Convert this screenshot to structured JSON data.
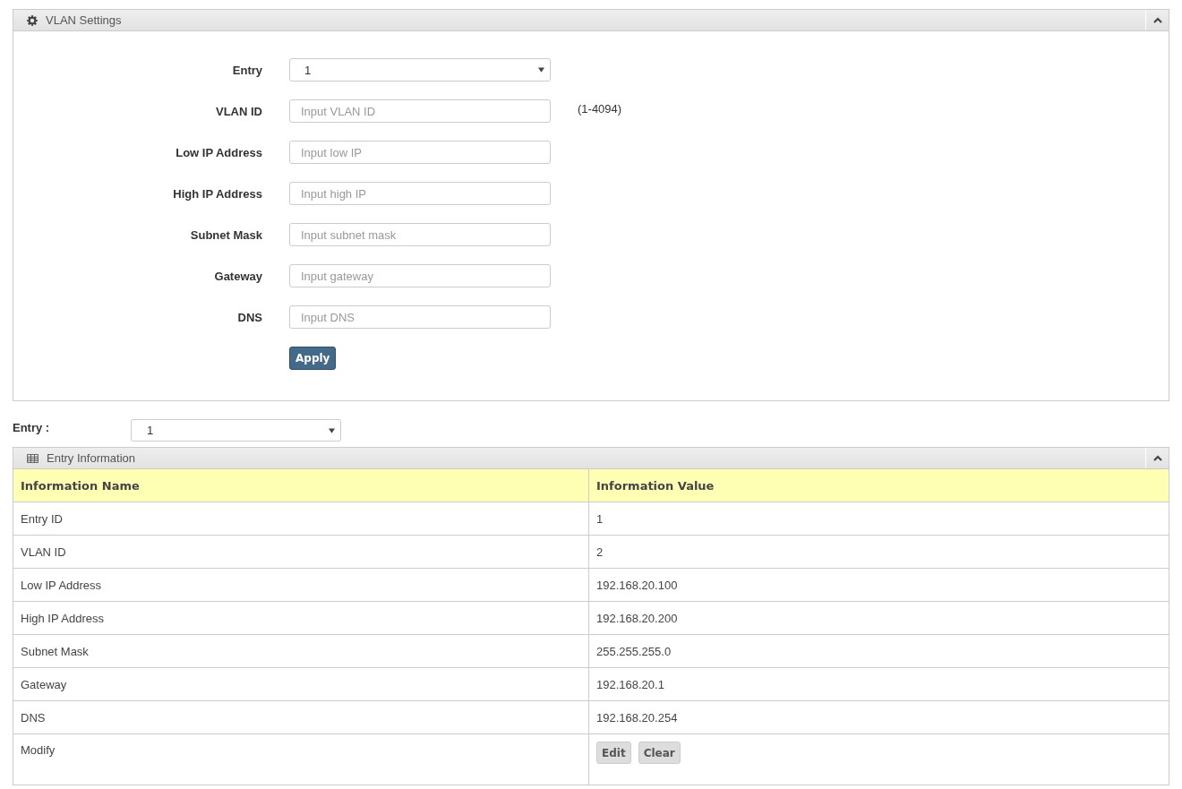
{
  "settings_panel": {
    "title": "VLAN Settings",
    "fields": [
      {
        "kind": "select",
        "label": "Entry",
        "value": "1"
      },
      {
        "kind": "text",
        "label": "VLAN ID",
        "placeholder": "Input VLAN ID",
        "hint": "(1-4094)"
      },
      {
        "kind": "text",
        "label": "Low IP Address",
        "placeholder": "Input low IP"
      },
      {
        "kind": "text",
        "label": "High IP Address",
        "placeholder": "Input high IP"
      },
      {
        "kind": "text",
        "label": "Subnet Mask",
        "placeholder": "Input subnet mask"
      },
      {
        "kind": "text",
        "label": "Gateway",
        "placeholder": "Input gateway"
      },
      {
        "kind": "text",
        "label": "DNS",
        "placeholder": "Input DNS"
      }
    ],
    "apply_button": "Apply"
  },
  "entry_selector": {
    "label": "Entry :",
    "value": "1"
  },
  "info_panel": {
    "title": "Entry Information",
    "columns": [
      "Information Name",
      "Information Value"
    ],
    "rows": [
      {
        "name": "Entry ID",
        "value": "1"
      },
      {
        "name": "VLAN ID",
        "value": "2"
      },
      {
        "name": "Low IP Address",
        "value": "192.168.20.100"
      },
      {
        "name": "High IP Address",
        "value": "192.168.20.200"
      },
      {
        "name": "Subnet Mask",
        "value": "255.255.255.0"
      },
      {
        "name": "Gateway",
        "value": "192.168.20.1"
      },
      {
        "name": "DNS",
        "value": "192.168.20.254"
      }
    ],
    "modify": {
      "name": "Modify",
      "buttons": [
        "Edit",
        "Clear"
      ]
    }
  }
}
